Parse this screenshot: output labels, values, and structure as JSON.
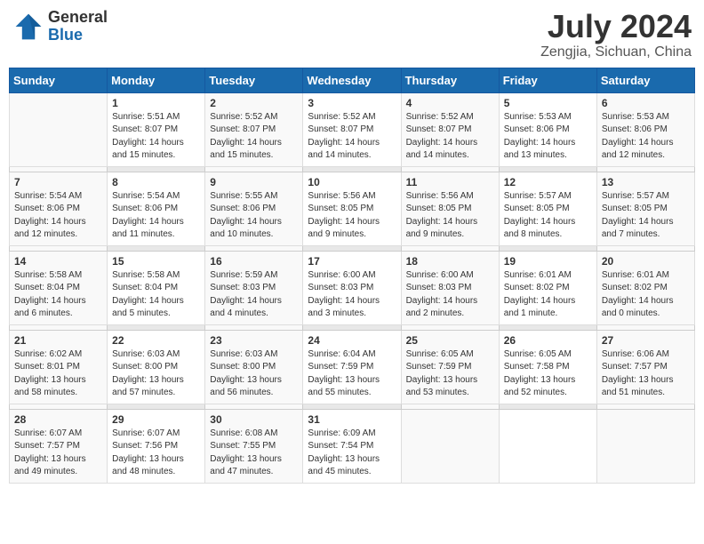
{
  "header": {
    "logo": {
      "line1": "General",
      "line2": "Blue"
    },
    "title": "July 2024",
    "subtitle": "Zengjia, Sichuan, China"
  },
  "weekdays": [
    "Sunday",
    "Monday",
    "Tuesday",
    "Wednesday",
    "Thursday",
    "Friday",
    "Saturday"
  ],
  "weeks": [
    [
      {
        "day": "",
        "info": ""
      },
      {
        "day": "1",
        "info": "Sunrise: 5:51 AM\nSunset: 8:07 PM\nDaylight: 14 hours\nand 15 minutes."
      },
      {
        "day": "2",
        "info": "Sunrise: 5:52 AM\nSunset: 8:07 PM\nDaylight: 14 hours\nand 15 minutes."
      },
      {
        "day": "3",
        "info": "Sunrise: 5:52 AM\nSunset: 8:07 PM\nDaylight: 14 hours\nand 14 minutes."
      },
      {
        "day": "4",
        "info": "Sunrise: 5:52 AM\nSunset: 8:07 PM\nDaylight: 14 hours\nand 14 minutes."
      },
      {
        "day": "5",
        "info": "Sunrise: 5:53 AM\nSunset: 8:06 PM\nDaylight: 14 hours\nand 13 minutes."
      },
      {
        "day": "6",
        "info": "Sunrise: 5:53 AM\nSunset: 8:06 PM\nDaylight: 14 hours\nand 12 minutes."
      }
    ],
    [
      {
        "day": "7",
        "info": "Sunrise: 5:54 AM\nSunset: 8:06 PM\nDaylight: 14 hours\nand 12 minutes."
      },
      {
        "day": "8",
        "info": "Sunrise: 5:54 AM\nSunset: 8:06 PM\nDaylight: 14 hours\nand 11 minutes."
      },
      {
        "day": "9",
        "info": "Sunrise: 5:55 AM\nSunset: 8:06 PM\nDaylight: 14 hours\nand 10 minutes."
      },
      {
        "day": "10",
        "info": "Sunrise: 5:56 AM\nSunset: 8:05 PM\nDaylight: 14 hours\nand 9 minutes."
      },
      {
        "day": "11",
        "info": "Sunrise: 5:56 AM\nSunset: 8:05 PM\nDaylight: 14 hours\nand 9 minutes."
      },
      {
        "day": "12",
        "info": "Sunrise: 5:57 AM\nSunset: 8:05 PM\nDaylight: 14 hours\nand 8 minutes."
      },
      {
        "day": "13",
        "info": "Sunrise: 5:57 AM\nSunset: 8:05 PM\nDaylight: 14 hours\nand 7 minutes."
      }
    ],
    [
      {
        "day": "14",
        "info": "Sunrise: 5:58 AM\nSunset: 8:04 PM\nDaylight: 14 hours\nand 6 minutes."
      },
      {
        "day": "15",
        "info": "Sunrise: 5:58 AM\nSunset: 8:04 PM\nDaylight: 14 hours\nand 5 minutes."
      },
      {
        "day": "16",
        "info": "Sunrise: 5:59 AM\nSunset: 8:03 PM\nDaylight: 14 hours\nand 4 minutes."
      },
      {
        "day": "17",
        "info": "Sunrise: 6:00 AM\nSunset: 8:03 PM\nDaylight: 14 hours\nand 3 minutes."
      },
      {
        "day": "18",
        "info": "Sunrise: 6:00 AM\nSunset: 8:03 PM\nDaylight: 14 hours\nand 2 minutes."
      },
      {
        "day": "19",
        "info": "Sunrise: 6:01 AM\nSunset: 8:02 PM\nDaylight: 14 hours\nand 1 minute."
      },
      {
        "day": "20",
        "info": "Sunrise: 6:01 AM\nSunset: 8:02 PM\nDaylight: 14 hours\nand 0 minutes."
      }
    ],
    [
      {
        "day": "21",
        "info": "Sunrise: 6:02 AM\nSunset: 8:01 PM\nDaylight: 13 hours\nand 58 minutes."
      },
      {
        "day": "22",
        "info": "Sunrise: 6:03 AM\nSunset: 8:00 PM\nDaylight: 13 hours\nand 57 minutes."
      },
      {
        "day": "23",
        "info": "Sunrise: 6:03 AM\nSunset: 8:00 PM\nDaylight: 13 hours\nand 56 minutes."
      },
      {
        "day": "24",
        "info": "Sunrise: 6:04 AM\nSunset: 7:59 PM\nDaylight: 13 hours\nand 55 minutes."
      },
      {
        "day": "25",
        "info": "Sunrise: 6:05 AM\nSunset: 7:59 PM\nDaylight: 13 hours\nand 53 minutes."
      },
      {
        "day": "26",
        "info": "Sunrise: 6:05 AM\nSunset: 7:58 PM\nDaylight: 13 hours\nand 52 minutes."
      },
      {
        "day": "27",
        "info": "Sunrise: 6:06 AM\nSunset: 7:57 PM\nDaylight: 13 hours\nand 51 minutes."
      }
    ],
    [
      {
        "day": "28",
        "info": "Sunrise: 6:07 AM\nSunset: 7:57 PM\nDaylight: 13 hours\nand 49 minutes."
      },
      {
        "day": "29",
        "info": "Sunrise: 6:07 AM\nSunset: 7:56 PM\nDaylight: 13 hours\nand 48 minutes."
      },
      {
        "day": "30",
        "info": "Sunrise: 6:08 AM\nSunset: 7:55 PM\nDaylight: 13 hours\nand 47 minutes."
      },
      {
        "day": "31",
        "info": "Sunrise: 6:09 AM\nSunset: 7:54 PM\nDaylight: 13 hours\nand 45 minutes."
      },
      {
        "day": "",
        "info": ""
      },
      {
        "day": "",
        "info": ""
      },
      {
        "day": "",
        "info": ""
      }
    ]
  ]
}
